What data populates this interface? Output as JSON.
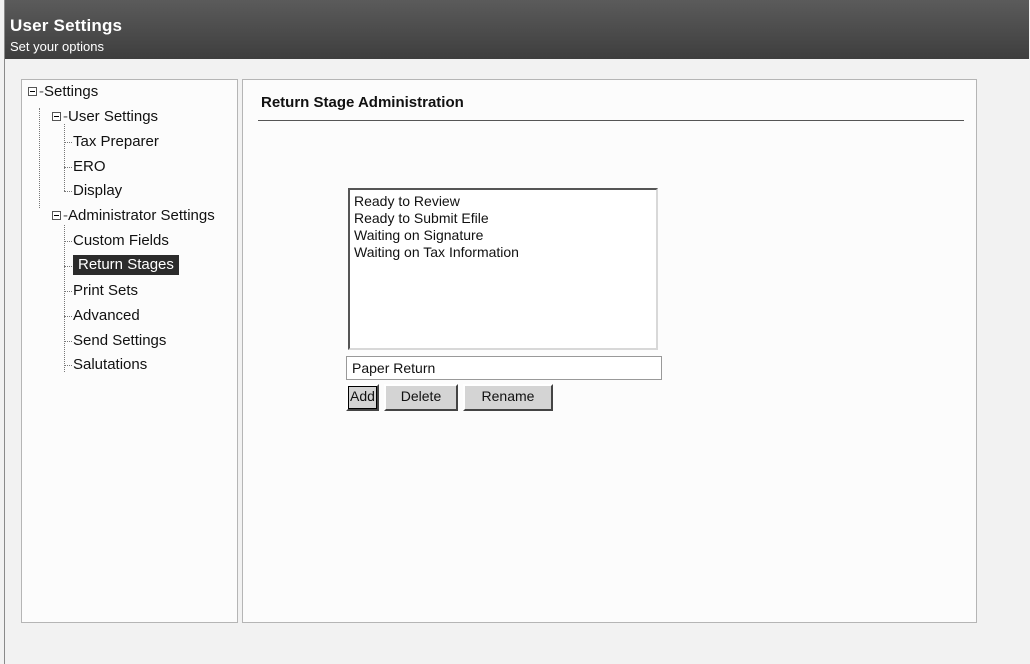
{
  "header": {
    "title": "User Settings",
    "subtitle": "Set your options"
  },
  "tree": {
    "root": "Settings",
    "user_settings": "User Settings",
    "tax_preparer": "Tax Preparer",
    "ero": "ERO",
    "display": "Display",
    "administrator_settings": "Administrator Settings",
    "custom_fields": "Custom Fields",
    "return_stages": "Return Stages",
    "print_sets": "Print Sets",
    "advanced": "Advanced",
    "send_settings": "Send Settings",
    "salutations": "Salutations",
    "selected": "Return Stages"
  },
  "main": {
    "title": "Return Stage Administration",
    "stages": [
      "Ready to Review",
      "Ready to Submit Efile",
      "Waiting on Signature",
      "Waiting on Tax Information"
    ],
    "input_value": "Paper Return",
    "add_label": "Add",
    "delete_label": "Delete",
    "rename_label": "Rename"
  }
}
